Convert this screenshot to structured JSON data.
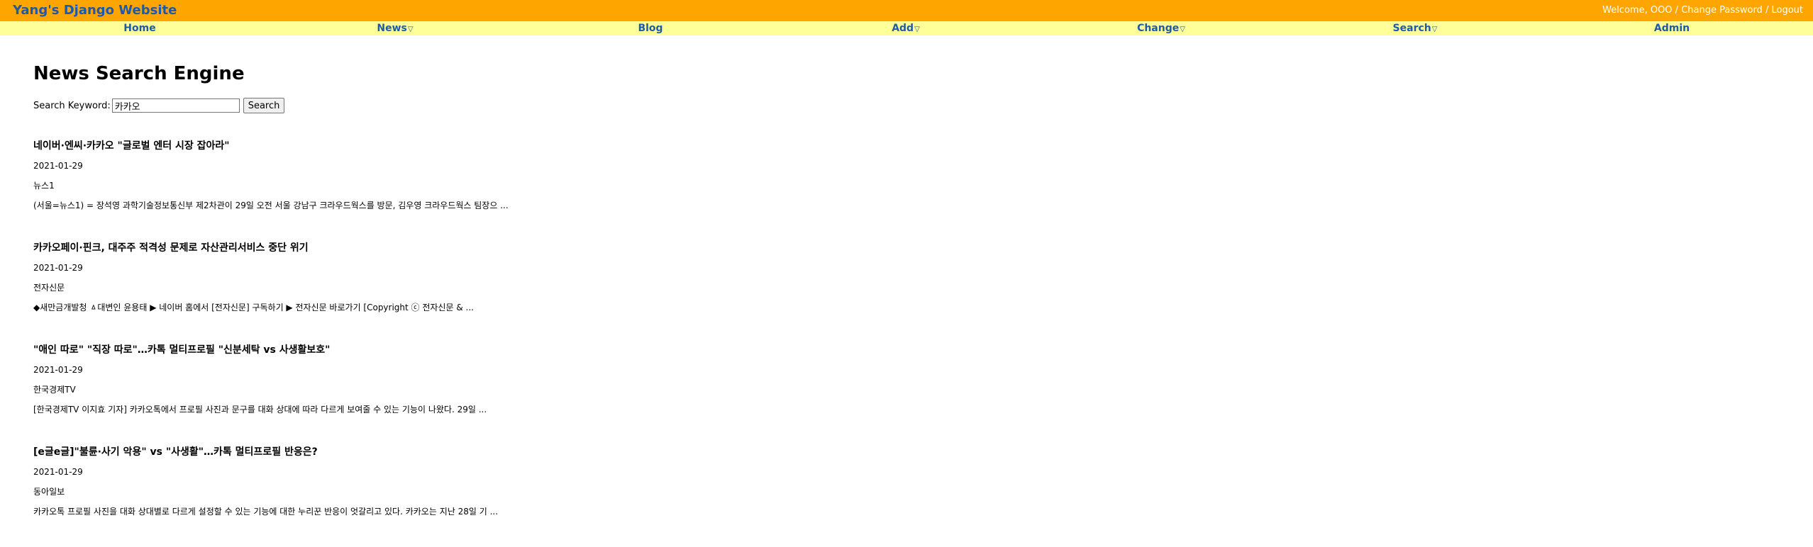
{
  "header": {
    "site_title": "Yang's Django Website",
    "welcome_text": "Welcome, OOO / ",
    "change_password": "Change Password",
    "separator": " / ",
    "logout": "Logout",
    "colors": {
      "topbar": "#ffa500",
      "navbar": "#ffff99",
      "link": "#1e5aa8"
    }
  },
  "nav": {
    "home": "Home",
    "news": "News",
    "blog": "Blog",
    "add": "Add",
    "change": "Change",
    "search": "Search",
    "admin": "Admin",
    "caret": "▽"
  },
  "page": {
    "title": "News Search Engine",
    "search_label": "Search Keyword:",
    "search_value": "카카오",
    "search_button": "Search"
  },
  "results": [
    {
      "title": "네이버·엔씨·카카오 \"글로벌 엔터 시장 잡아라\"",
      "date": "2021-01-29",
      "source": "뉴스1",
      "summary": "(서울=뉴스1) = 장석영 과학기술정보통신부 제2차관이 29일 오전 서울 강남구 크라우드웍스를 방문, 김우영 크라우드웍스 팀장으 ..."
    },
    {
      "title": "카카오페이·핀크, 대주주 적격성 문제로 자산관리서비스 중단 위기",
      "date": "2021-01-29",
      "source": "전자신문",
      "summary": "◆새만금개발청 ㅿ대변인 윤용태 ▶ 네이버 홈에서 [전자신문] 구독하기 ▶ 전자신문 바로가기 [Copyright ⓒ 전자신문 & ..."
    },
    {
      "title": "\"애인 따로\" \"직장 따로\"…카톡 멀티프로필 \"신분세탁 vs 사생활보호\"",
      "date": "2021-01-29",
      "source": "한국경제TV",
      "summary": "[한국경제TV 이지효 기자] 카카오톡에서 프로필 사진과 문구를 대화 상대에 따라 다르게 보여줄 수 있는 기능이 나왔다. 29일 ..."
    },
    {
      "title": "[e글e글]\"불륜·사기 악용\" vs \"사생활\"…카톡 멀티프로필 반응은?",
      "date": "2021-01-29",
      "source": "동아일보",
      "summary": "카카오톡 프로필 사진을 대화 상대별로 다르게 설정할 수 있는 기능에 대한 누리꾼 반응이 엇갈리고 있다. 카카오는 지난 28일 기 ..."
    }
  ]
}
